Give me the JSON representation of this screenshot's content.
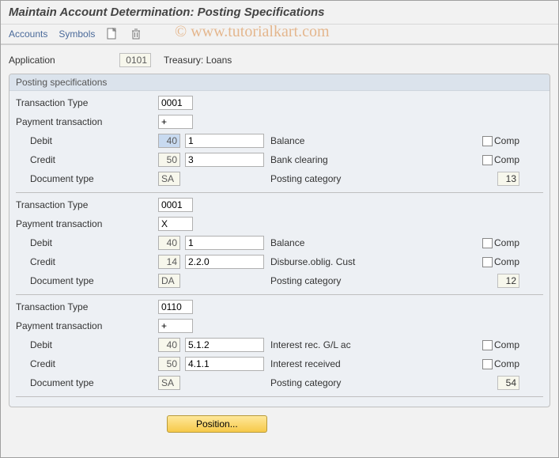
{
  "title": "Maintain Account Determination: Posting Specifications",
  "watermark": "© www.tutorialkart.com",
  "toolbar": {
    "accounts": "Accounts",
    "symbols": "Symbols"
  },
  "application": {
    "label": "Application",
    "value": "0101",
    "desc": "Treasury: Loans"
  },
  "group_title": "Posting specifications",
  "labels": {
    "txn_type": "Transaction Type",
    "pay_txn": "Payment transaction",
    "debit": "Debit",
    "credit": "Credit",
    "doc_type": "Document type",
    "posting_cat": "Posting category",
    "comp": "Comp"
  },
  "blocks": [
    {
      "txn_type": "0001",
      "pay_txn": "+",
      "debit_key": "40",
      "debit_key_sel": true,
      "debit_sym": "1",
      "debit_desc": "Balance",
      "credit_key": "50",
      "credit_sym": "3",
      "credit_desc": "Bank clearing",
      "doc_type": "SA",
      "posting_cat": "13"
    },
    {
      "txn_type": "0001",
      "pay_txn": "X",
      "debit_key": "40",
      "debit_key_sel": false,
      "debit_sym": "1",
      "debit_desc": "Balance",
      "credit_key": "14",
      "credit_sym": "2.2.0",
      "credit_desc": "Disburse.oblig. Cust",
      "doc_type": "DA",
      "posting_cat": "12"
    },
    {
      "txn_type": "0110",
      "pay_txn": "+",
      "debit_key": "40",
      "debit_key_sel": false,
      "debit_sym": "5.1.2",
      "debit_desc": "Interest rec. G/L ac",
      "credit_key": "50",
      "credit_sym": "4.1.1",
      "credit_desc": "Interest received",
      "doc_type": "SA",
      "posting_cat": "54"
    }
  ],
  "position_btn": "Position..."
}
